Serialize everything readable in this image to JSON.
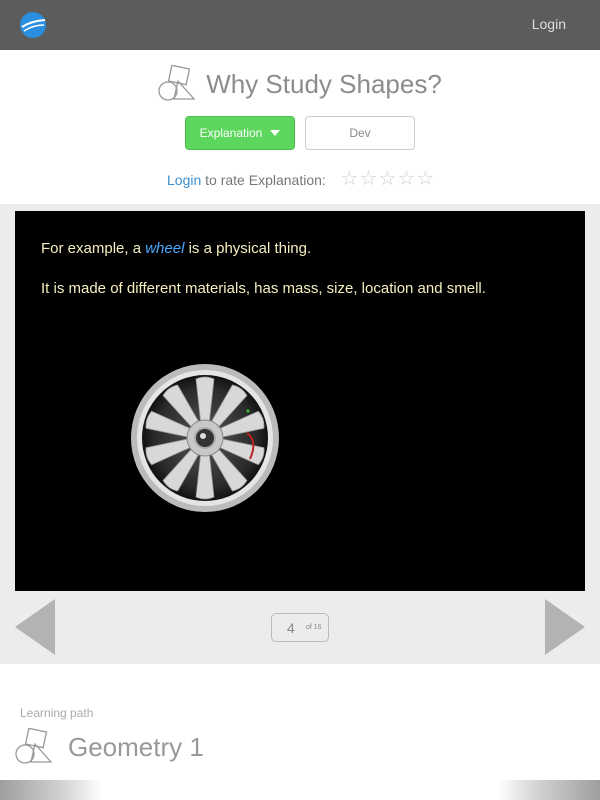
{
  "header": {
    "login_label": "Login"
  },
  "page": {
    "title": "Why Study Shapes?"
  },
  "tabs": {
    "explanation_label": "Explanation",
    "dev_label": "Dev"
  },
  "rating": {
    "login_link": "Login",
    "prompt": " to rate Explanation:",
    "stars": 5,
    "value": 0
  },
  "slide": {
    "line1_before": "For example, a ",
    "line1_emphasis": "wheel",
    "line1_after": " is a physical thing.",
    "line2": "It is made of different materials, has mass, size, location and smell."
  },
  "pager": {
    "current": "4",
    "total_label": "of 16"
  },
  "learning_path": {
    "label": "Learning path",
    "title": "Geometry 1"
  },
  "colors": {
    "topbar": "#5c5c5c",
    "accent_green": "#5cd65c",
    "link_blue": "#3a8fd0",
    "slide_text": "#f5eec0",
    "emphasis_blue": "#4aa7ff"
  }
}
